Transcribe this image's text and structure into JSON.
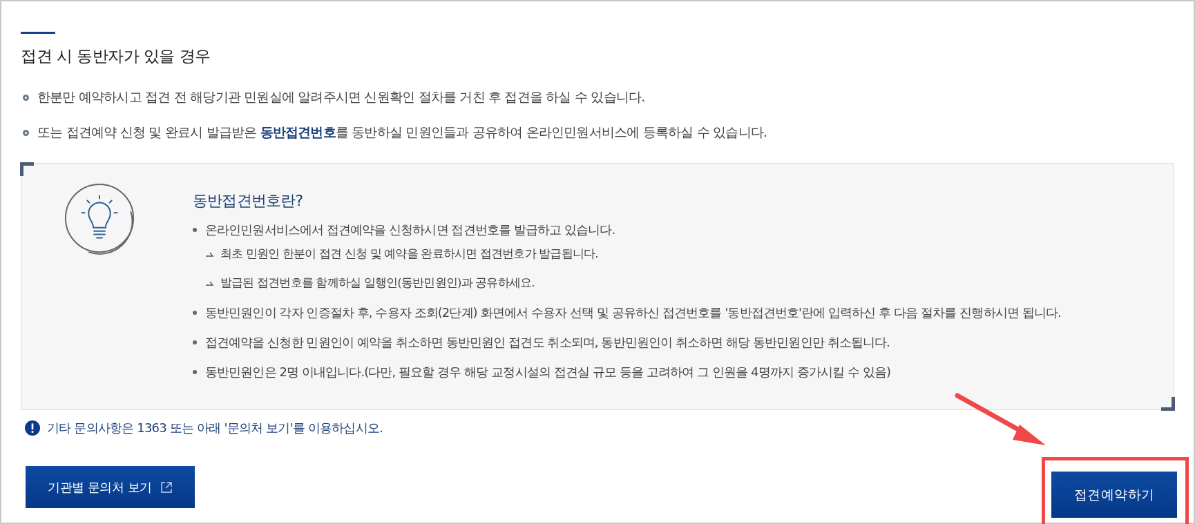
{
  "section": {
    "title": "접견 시 동반자가 있을 경우",
    "bullets": [
      {
        "text": "한분만 예약하시고 접견 전 해당기관 민원실에 알려주시면 신원확인 절차를 거친 후 접견을 하실 수 있습니다."
      },
      {
        "text": "또는 접견예약 신청 및 완료시 발급받은 **동반접견번호**를 동반하실 민원인들과 공유하여 온라인민원서비스에 등록하실 수 있습니다."
      }
    ]
  },
  "info_box": {
    "title": "동반접견번호란?",
    "items": [
      {
        "text": "온라인민원서비스에서 접견예약을 신청하시면 접견번호를 발급하고 있습니다.",
        "children": [
          {
            "text": "최초 민원인 한분이 접견 신청 및 예약을 완료하시면 접견번호가 발급됩니다."
          },
          {
            "text": "발급된 접견번호를 함께하실 일행인(동반민원인)과 공유하세요."
          }
        ]
      },
      {
        "text": "동반민원인이 각자 인증절차 후, 수용자 조회(2단계) 화면에서 수용자 선택 및 공유하신 접견번호를 '동반접견번호'란에 입력하신 후 다음 절차를 진행하시면 됩니다."
      },
      {
        "text": "접견예약을 신청한 민원인이 예약을 취소하면 동반민원인 접견도 취소되며, 동반민원인이 취소하면 해당 동반민원인만 취소됩니다."
      },
      {
        "text": "동반민원인은 2명 이내입니다.(다만, 필요할 경우 해당 교정시설의 접견실 규모 등을 고려하여 그 인원을 4명까지 증가시킬 수 있음)"
      }
    ]
  },
  "notice": "기타 문의사항은 1363 또는 아래 '문의처 보기'를 이용하십시오.",
  "buttons": [
    {
      "label": "기관별 문의처 보기",
      "kind": "external"
    },
    {
      "label": "접견예약하기",
      "kind": "primary"
    }
  ]
}
